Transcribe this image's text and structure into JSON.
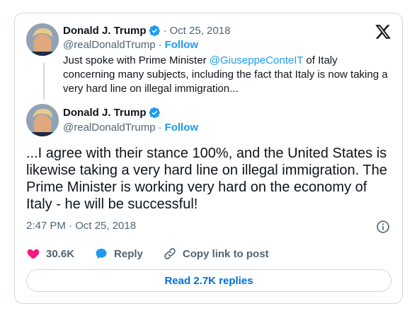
{
  "quoted_tweet": {
    "author_name": "Donald J. Trump",
    "separator": "·",
    "date": "Oct 25, 2018",
    "handle": "@realDonaldTrump",
    "follow_sep": "·",
    "follow_label": "Follow",
    "text_before": "Just spoke with Prime Minister ",
    "mention": "@GiuseppeConteIT",
    "text_after": " of Italy concerning many subjects, including the fact that Italy is now taking a very hard line on illegal immigration..."
  },
  "main_tweet": {
    "author_name": "Donald J. Trump",
    "handle": "@realDonaldTrump",
    "follow_sep": "·",
    "follow_label": "Follow",
    "text": "...I agree with their stance 100%, and the United States is likewise taking a very hard line on illegal immigration. The Prime Minister is working very hard on the economy of Italy - he will be successful!",
    "timestamp": "2:47 PM · Oct 25, 2018"
  },
  "actions": {
    "likes": "30.6K",
    "reply_label": "Reply",
    "copy_link_label": "Copy link to post"
  },
  "read_replies_label": "Read 2.7K replies",
  "colors": {
    "accent": "#1d9bf0",
    "like": "#f91880",
    "text": "#0f1419",
    "muted": "#536471",
    "border": "#cfd9de"
  }
}
